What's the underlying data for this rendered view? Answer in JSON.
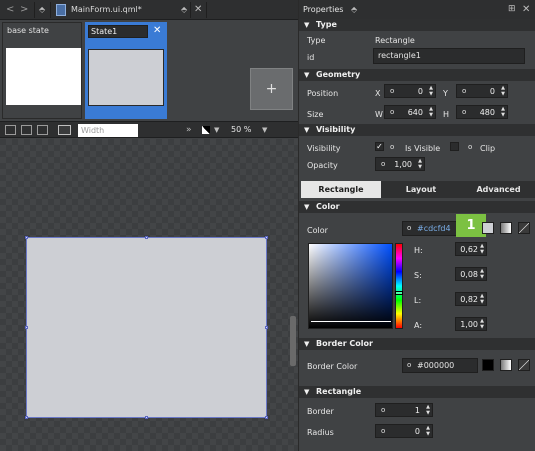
{
  "toolbar": {
    "back_label": "<",
    "forward_label": ">",
    "file_title": "MainForm.ui.qml*",
    "file_dropdown": "⬘",
    "close_label": "✕"
  },
  "states": {
    "base": {
      "label": "base state"
    },
    "state1": {
      "label": "State1",
      "close_label": "✕"
    },
    "add_label": "+"
  },
  "canvas_toolbar": {
    "width_placeholder": "Width",
    "overflow_label": "»",
    "zoom_value": "50 %"
  },
  "properties": {
    "header_title": "Properties",
    "type_section": {
      "title": "Type",
      "type_label": "Type",
      "type_value": "Rectangle",
      "id_label": "id",
      "id_value": "rectangle1"
    },
    "geometry_section": {
      "title": "Geometry",
      "position_label": "Position",
      "x_label": "X",
      "x_value": "0",
      "y_label": "Y",
      "y_value": "0",
      "size_label": "Size",
      "w_label": "W",
      "w_value": "640",
      "h_label": "H",
      "h_value": "480"
    },
    "visibility_section": {
      "title": "Visibility",
      "visibility_label": "Visibility",
      "is_visible_label": "Is Visible",
      "is_visible_checked": true,
      "clip_label": "Clip",
      "clip_checked": false,
      "opacity_label": "Opacity",
      "opacity_value": "1,00"
    },
    "tabs": [
      {
        "label": "Rectangle",
        "active": true
      },
      {
        "label": "Layout",
        "active": false
      },
      {
        "label": "Advanced",
        "active": false
      }
    ],
    "color_section": {
      "title": "Color",
      "color_label": "Color",
      "color_value": "#cdcfd4",
      "badge": "1",
      "h_label": "H:",
      "h_value": "0,62",
      "s_label": "S:",
      "s_value": "0,08",
      "l_label": "L:",
      "l_value": "0,82",
      "a_label": "A:",
      "a_value": "1,00"
    },
    "border_color_section": {
      "title": "Border Color",
      "label": "Border Color",
      "value": "#000000"
    },
    "rectangle_section": {
      "title": "Rectangle",
      "border_label": "Border",
      "border_value": "1",
      "radius_label": "Radius",
      "radius_value": "0"
    }
  },
  "colors": {
    "rect_fill": "#cdcfd4",
    "selection_accent": "#3a7bd5",
    "badge_green": "#7cc142",
    "border_color_swatch": "#000000"
  }
}
